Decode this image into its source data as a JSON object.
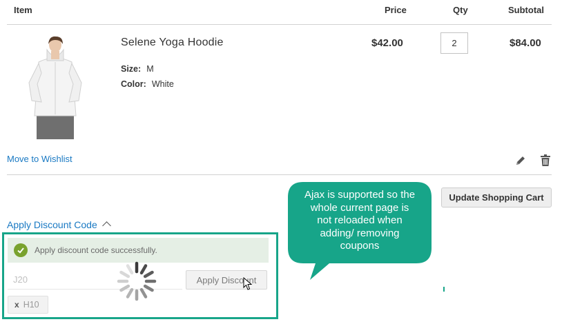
{
  "table_header": {
    "item": "Item",
    "price": "Price",
    "qty": "Qty",
    "subtotal": "Subtotal"
  },
  "cart_item": {
    "name": "Selene Yoga Hoodie",
    "options": [
      {
        "label": "Size:",
        "value": "M"
      },
      {
        "label": "Color:",
        "value": "White"
      }
    ],
    "price": "$42.00",
    "qty": "2",
    "subtotal": "$84.00",
    "move_to_wishlist": "Move to Wishlist",
    "edit_icon": "pencil-icon",
    "delete_icon": "trash-icon"
  },
  "actions": {
    "update_cart": "Update Shopping Cart"
  },
  "discount": {
    "toggle_label": "Apply Discount Code",
    "toggle_icon": "chevron-up-icon",
    "success_message": "Apply discount code successfully.",
    "input_value": "J20",
    "apply_button": "Apply Discount",
    "applied_coupons": [
      {
        "remove": "x",
        "code": "H10"
      }
    ]
  },
  "callout": {
    "lines": [
      "Ajax is supported so the",
      "whole current page is",
      "not reloaded when",
      "adding/ removing",
      "coupons"
    ]
  },
  "colors": {
    "link": "#1979c3",
    "callout": "#17a589",
    "success_bg": "#e5efe5",
    "success_icon": "#79a22e"
  }
}
